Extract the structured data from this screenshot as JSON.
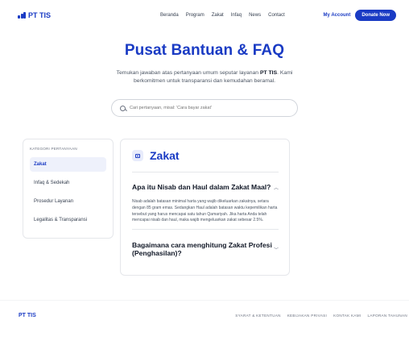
{
  "brand": {
    "name": "PT TIS",
    "accent": "#1a3bc4"
  },
  "nav": {
    "items": [
      "Beranda",
      "Program",
      "Zakat",
      "Infaq",
      "News",
      "Contact"
    ]
  },
  "header": {
    "account": "My Account",
    "donate": "Donate Now"
  },
  "hero": {
    "title": "Pusat Bantuan & FAQ",
    "desc_pre": "Temukan jawaban atas pertanyaan umum seputar layanan ",
    "desc_strong": "PT TIS",
    "desc_post": ". Kami berkomitmen untuk transparansi dan kemudahan beramal."
  },
  "search": {
    "placeholder": "Cari pertanyaan, misal: 'Cara bayar zakat'",
    "icon": "search-icon"
  },
  "sidebar": {
    "title": "KATEGORI PERTANYAAN",
    "items": [
      {
        "label": "Zakat"
      },
      {
        "label": "Infaq & Sedekah"
      },
      {
        "label": "Prosedur Layanan"
      },
      {
        "label": "Legalitas & Transparansi"
      }
    ]
  },
  "panel": {
    "title": "Zakat",
    "faqs": [
      {
        "question": "Apa itu Nisab dan Haul dalam Zakat Maal?",
        "answer": "Nisab adalah batasan minimal harta yang wajib dikeluarkan zakatnya, setara dengan 85 gram emas. Sedangkan Haul adalah batasan waktu kepemilikan harta tersebut yang harus mencapai satu tahun Qamariyah. Jika harta Anda telah mencapai nisab dan haul, maka wajib mengeluarkan zakat sebesar 2.5%."
      },
      {
        "question": "Bagaimana cara menghitung Zakat Profesi (Penghasilan)?"
      }
    ]
  },
  "footer": {
    "brand": "PT TIS",
    "links": [
      "SYARAT & KETENTUAN",
      "KEBIJAKAN PRIVASI",
      "KONTAK KAMI",
      "LAPORAN TAHUNAN"
    ]
  }
}
